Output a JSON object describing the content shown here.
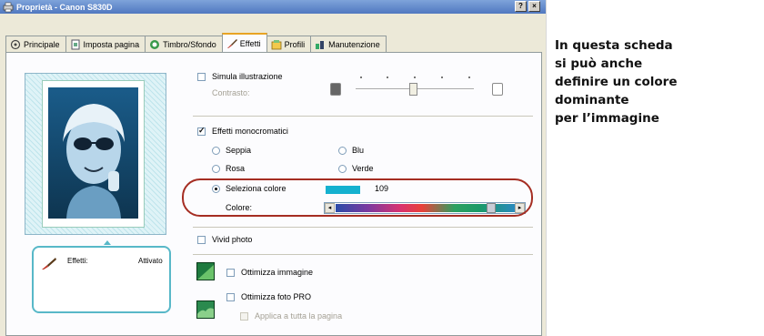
{
  "window": {
    "title": "Proprietà - Canon S830D",
    "help_label": "?",
    "close_label": "×"
  },
  "tabs": [
    {
      "label": "Principale"
    },
    {
      "label": "Imposta pagina"
    },
    {
      "label": "Timbro/Sfondo"
    },
    {
      "label": "Effetti"
    },
    {
      "label": "Profili"
    },
    {
      "label": "Manutenzione"
    }
  ],
  "options": {
    "simula_illustrazione": {
      "label": "Simula illustrazione",
      "checked": false
    },
    "contrasto_label": "Contrasto:",
    "effetti_monocromatici": {
      "label": "Effetti monocromatici",
      "checked": true
    },
    "radios": {
      "seppia": "Seppia",
      "blu": "Blu",
      "rosa": "Rosa",
      "verde": "Verde",
      "seleziona_colore": "Seleziona colore"
    },
    "selected_radio": "seleziona_colore",
    "color_value": "109",
    "colore_label": "Colore:",
    "vivid_photo": {
      "label": "Vivid photo",
      "checked": false
    },
    "ottimizza_immagine": {
      "label": "Ottimizza immagine",
      "checked": false
    },
    "ottimizza_foto_pro": {
      "label": "Ottimizza foto PRO",
      "checked": false
    },
    "applica_pagina": {
      "label": "Applica a tutta la pagina",
      "checked": false
    }
  },
  "status": {
    "label": "Effetti:",
    "value": "Attivato"
  },
  "caption": {
    "lines": [
      "In questa scheda",
      "si può anche",
      "definire un colore",
      "dominante",
      "per l’immagine"
    ]
  },
  "colors": {
    "selected_color": "#15b1cf",
    "highlight": "#a52d22",
    "accent_tab": "#e8a424"
  }
}
